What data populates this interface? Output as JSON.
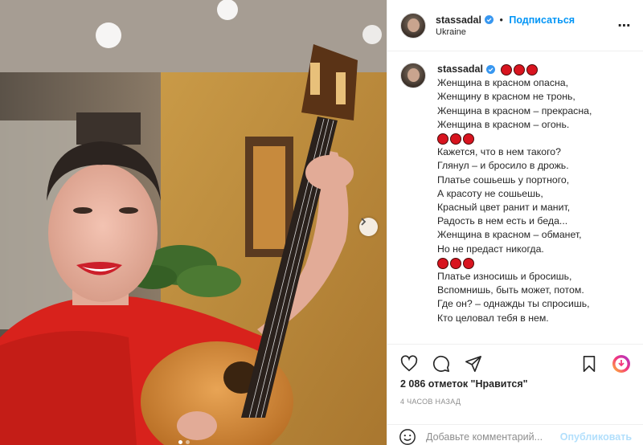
{
  "post": {
    "username": "stassadal",
    "follow_label": "Подписаться",
    "separator": "•",
    "location": "Ukraine",
    "caption_lines": [
      "Женщина в красном опасна,",
      "Женщину в красном не тронь,",
      "Женщина в красном – прекрасна,",
      "Женщина в красном – огонь.",
      "",
      "Кажется, что в нем такого?",
      "Глянул – и бросило в дрожь.",
      "Платье сошьешь у портного,",
      "А красоту не сошьешь,",
      "Красный цвет ранит и манит,",
      "Радость в нем есть и беда...",
      "Женщина в красном – обманет,",
      "Но не предаст никогда.",
      "",
      "Платье износишь и бросишь,",
      "Вспомнишь, быть может, потом.",
      "Где он? – однажды ты спросишь,",
      "Кто целовал тебя в нем."
    ],
    "likes": "2 086 отметок \"Нравится\"",
    "time": "4 ЧАСОВ НАЗАД",
    "comment_placeholder": "Добавьте комментарий...",
    "publish_label": "Опубликовать"
  },
  "icons": {
    "verified": "verified-badge-icon",
    "more": "more-options-icon",
    "like": "heart-icon",
    "comment": "comment-icon",
    "share": "share-icon",
    "save": "bookmark-icon",
    "emoji": "emoji-icon",
    "next": "chevron-right-icon",
    "reels": "reels-badge-icon"
  },
  "colors": {
    "accent": "#0095f6",
    "publish_disabled": "#b2dffc",
    "emoji_red": "#d8141f"
  },
  "carousel": {
    "count": 2,
    "active": 0
  }
}
